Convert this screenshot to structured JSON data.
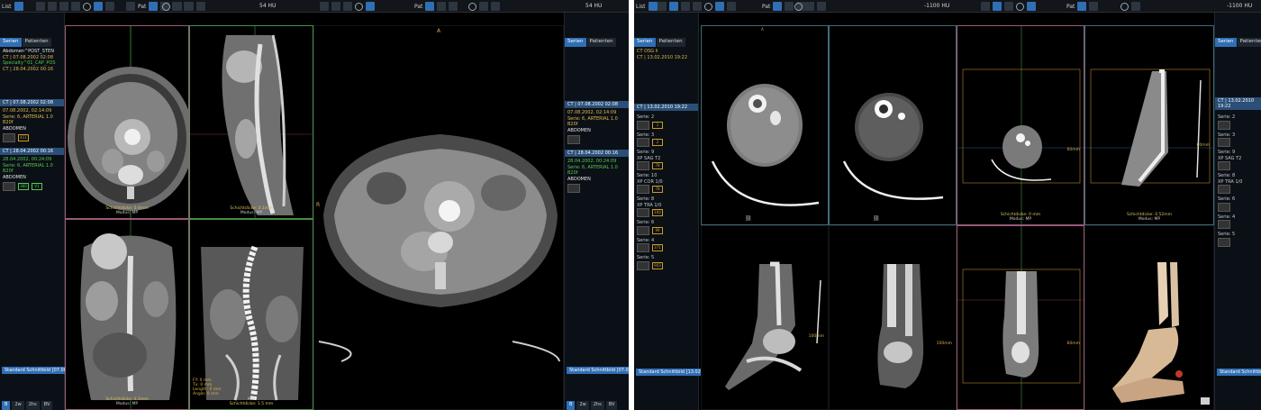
{
  "left": {
    "toolbar": {
      "list_label": "List",
      "patient_label": "Pat",
      "hu_left": "54 HU",
      "hu_right": "54 HU"
    },
    "sidebar_left": {
      "tabs": [
        {
          "label": "Serien",
          "active": true
        },
        {
          "label": "Patienten",
          "active": false
        }
      ],
      "patient_name": "Abdomen^POST_STEN",
      "study1": "CT | 07.08.2002 02:08",
      "study2_text": "Specialty^01_CAP_POS",
      "study3": "CT | 28.04.2002 00:16",
      "series_title": "CT | 07.08.2002 02:08",
      "series_date": "07.08.2002, 02:14:09",
      "series_desc": "Serie: 6, ARTERIAL 1.0 B20f",
      "series_region": "ABDOMEN",
      "series2_title": "CT | 28.04.2002 00:16",
      "series2_date": "28.04.2002, 00:24:09",
      "series2_desc": "Serie: 6, ARTERIAL 1.0 B20f",
      "series2_region": "ABDOMEN",
      "thumb_count1": "411",
      "thumb_count2": "360",
      "thumb_count3": "V1",
      "standard_button": "Standard Schnittbild [07.08.0"
    },
    "sidebar_right": {
      "tabs": [
        {
          "label": "Serien",
          "active": true
        },
        {
          "label": "Patienten",
          "active": false
        }
      ],
      "series_title": "CT | 07.08.2002 02:08",
      "series_date": "07.08.2002, 02:14:09",
      "series_desc": "Serie: 6, ARTERIAL 1.0 B20f",
      "series_region": "ABDOMEN",
      "series2_title": "CT | 28.04.2002 00:16",
      "series2_date": "28.04.2002, 00:24:09",
      "series2_desc": "Serie: 6, ARTERIAL 1.0 B20f",
      "series2_region": "ABDOMEN",
      "standard_button": "Standard Schnittbild [07.08.0"
    },
    "bottom_tabs": [
      {
        "label": "B",
        "active": true
      },
      {
        "label": "2w",
        "active": false
      },
      {
        "label": "2hs",
        "active": false
      },
      {
        "label": "BV",
        "active": false
      }
    ],
    "viewports": {
      "axial_small": {
        "caption": "Schichtdicke: 0.6mm",
        "sub": "Modus: MP"
      },
      "sagittal": {
        "caption": "Schichtdicke: 0.1mm",
        "sub": "Modus: MP"
      },
      "coronal": {
        "caption": "Schichtdicke: 0.1mm",
        "sub": "Modus: MP"
      },
      "coronal_mip": {
        "caption": "Schichtdicke: 1.5 mm",
        "sub": "MIP",
        "info1": "FY: 0 mm",
        "info2": "Tx: 0 mm",
        "info3": "Length: 0 mm",
        "info4": "Angle: 0 mm"
      },
      "axial_large": {
        "marker_a": "A",
        "marker_r": "R"
      }
    }
  },
  "right": {
    "toolbar": {
      "list_label": "List",
      "patient_label": "Pat",
      "hu_left": "-1100 HU",
      "hu_right": "-1100 HU"
    },
    "sidebar_left": {
      "tabs": [
        {
          "label": "Serien",
          "active": true
        },
        {
          "label": "Patienten",
          "active": false
        }
      ],
      "patient_name": "CT OSG li",
      "study1": "CT | 13.02.2010 19:22",
      "series_title": "CT | 13.02.2010 19:22",
      "series_items": [
        {
          "label": "Serie: 2",
          "count": "1"
        },
        {
          "label": "Serie: 3",
          "count": "2"
        },
        {
          "label": "Serie: 9",
          "sub": "XP SAG T2",
          "count": "78"
        },
        {
          "label": "Serie: 10",
          "sub": "XP COR 1/0",
          "count": "78"
        },
        {
          "label": "Serie: 8",
          "sub": "XP TRA 1/0",
          "count": "160"
        },
        {
          "label": "Serie: 6",
          "count": "99"
        },
        {
          "label": "Serie: 4",
          "count": "371"
        },
        {
          "label": "Serie: 5",
          "count": "903"
        }
      ],
      "standard_button": "Standard Schnittbild [13.02.2"
    },
    "sidebar_right": {
      "tabs": [
        {
          "label": "Serien",
          "active": true
        },
        {
          "label": "Patienten",
          "active": false
        }
      ],
      "series_title": "CT | 13.02.2010 19:22",
      "standard_button": "Standard Schnittbild"
    },
    "viewports": {
      "top_axial_soft": {
        "caption": ""
      },
      "top_axial_bone": {
        "caption": ""
      },
      "top_axial_small": {
        "caption": "Schichtdicke: 0 mm",
        "sub": "Modus: MP",
        "meas": "60mm"
      },
      "top_sag": {
        "caption": "Schichtdicke: 0.52mm",
        "sub": "Modus: MP",
        "meas": "60mm"
      },
      "bot_sag": {
        "meas": "100mm"
      },
      "bot_cor": {
        "meas": "100mm"
      },
      "bot_cor_small": {
        "meas": "60mm"
      },
      "bot_3d": {}
    }
  }
}
